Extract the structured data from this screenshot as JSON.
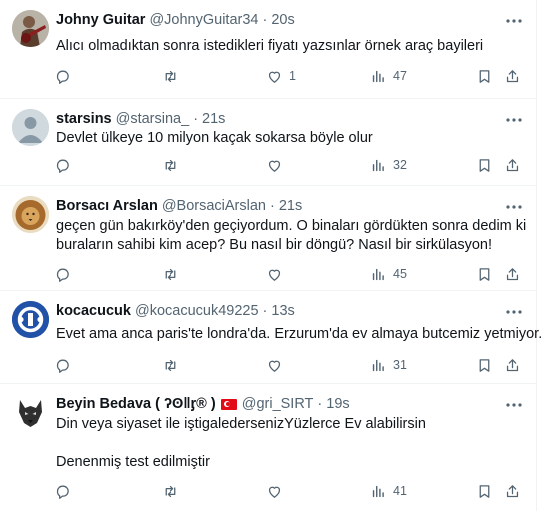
{
  "colors": {
    "text": "#0f1419",
    "muted": "#536471",
    "border": "#eff3f4"
  },
  "tweets": [
    {
      "name": "Johny Guitar",
      "handle": "@JohnyGuitar34",
      "time": "20s",
      "text": [
        "Alıcı olmadıktan sonra istedikleri fiyatı yazsınlar örnek araç bayileri"
      ],
      "likes": "1",
      "views": "47",
      "avatar_icon": "guitar-player-avatar"
    },
    {
      "name": "starsins",
      "handle": "@starsina_",
      "time": "21s",
      "text": [
        "Devlet ülkeye 10 milyon kaçak sokarsa böyle olur"
      ],
      "likes": "",
      "views": "32",
      "avatar_icon": "default-person-avatar"
    },
    {
      "name": "Borsacı Arslan",
      "handle": "@BorsaciArslan",
      "time": "21s",
      "text": [
        "geçen gün bakırköy'den geçiyordum.  O binaları gördükten sonra dedim ki",
        "buraların sahibi kim acep? Bu nasıl bir döngü? Nasıl bir sirkülasyon!"
      ],
      "likes": "",
      "views": "45",
      "avatar_icon": "lion-avatar"
    },
    {
      "name": "kocacucuk",
      "handle": "@kocacucuk49225",
      "time": "13s",
      "text": [
        "Evet ama anca paris'te londra'da. Erzurum'da ev almaya butcemiz yetmiyor."
      ],
      "likes": "",
      "views": "31",
      "avatar_icon": "blue-logo-avatar"
    },
    {
      "name": "Beyin Bedava ( ʔʘǁᶉ® )",
      "handle": "@gri_SIRT",
      "time": "19s",
      "text": [
        "Din veya siyaset ile iştigaledersenizYüzlerce Ev alabilirsin",
        "",
        "Denenmiş test edilmiştir"
      ],
      "likes": "",
      "views": "41",
      "avatar_icon": "wolf-avatar",
      "flag": "turkey-flag-icon"
    }
  ]
}
